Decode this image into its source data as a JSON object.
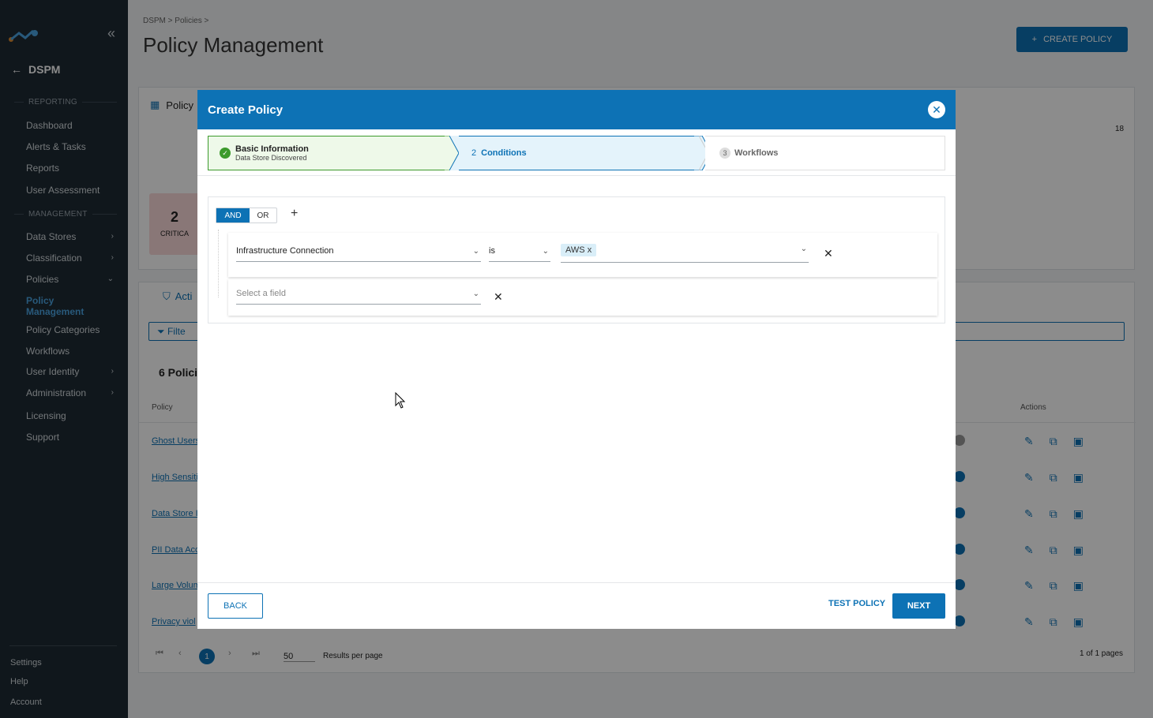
{
  "sidebar": {
    "back_label": "DSPM",
    "reporting_header": "REPORTING",
    "management_header": "MANAGEMENT",
    "reporting_items": [
      "Dashboard",
      "Alerts & Tasks",
      "Reports",
      "User Assessment"
    ],
    "management_items": [
      "Data Stores",
      "Classification",
      "Policies"
    ],
    "policy_active_line1": "Policy",
    "policy_active_line2": "Management",
    "policy_sub_items": [
      "Policy Categories",
      "Workflows"
    ],
    "other_items": [
      "User Identity",
      "Administration",
      "Licensing",
      "Support"
    ],
    "footer": [
      "Settings",
      "Help",
      "Account"
    ]
  },
  "page": {
    "breadcrumb": "DSPM > Policies >",
    "title": "Policy Management",
    "create_button": "CREATE POLICY",
    "card_title_partial": "Policy",
    "critical_count": "2",
    "critical_label": "CRITICA",
    "count_18": "18",
    "tab_partial": "Acti",
    "filter_partial": "Filte",
    "policies_count": "6 Polici",
    "col_policy": "Policy",
    "col_actions": "Actions",
    "rows": [
      "Ghost Users",
      "High Sensiti",
      "Data Store I",
      "PII Data Acc",
      "Large Volum",
      "Privacy viol"
    ],
    "page_num": "1",
    "per_page": "50",
    "results_label": "Results per page",
    "pages_label": "1 of 1 pages"
  },
  "modal": {
    "title": "Create Policy",
    "steps": {
      "step1_title": "Basic Information",
      "step1_sub": "Data Store Discovered",
      "step2_num": "2",
      "step2_title": "Conditions",
      "step3_num": "3",
      "step3_title": "Workflows"
    },
    "and_label": "AND",
    "or_label": "OR",
    "condition1": {
      "field": "Infrastructure Connection",
      "operator": "is",
      "value_tag": "AWS"
    },
    "condition2": {
      "placeholder": "Select a field"
    },
    "back_button": "BACK",
    "test_button": "TEST POLICY",
    "next_button": "NEXT"
  },
  "colors": {
    "primary": "#0d72b5",
    "sidebar_bg": "#1e2a33",
    "success": "#3c9a2c"
  }
}
